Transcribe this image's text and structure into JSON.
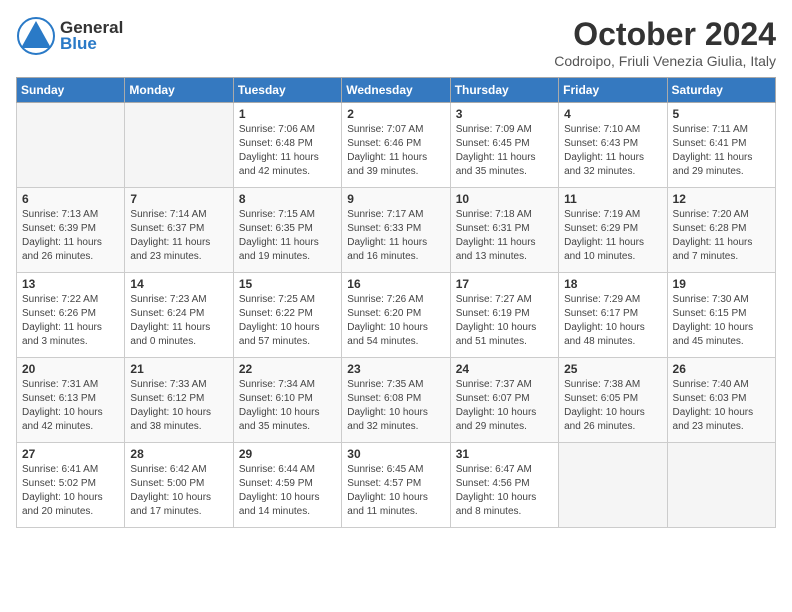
{
  "logo": {
    "text_general": "General",
    "text_blue": "Blue"
  },
  "title": "October 2024",
  "location": "Codroipo, Friuli Venezia Giulia, Italy",
  "days_of_week": [
    "Sunday",
    "Monday",
    "Tuesday",
    "Wednesday",
    "Thursday",
    "Friday",
    "Saturday"
  ],
  "weeks": [
    [
      {
        "day": "",
        "info": ""
      },
      {
        "day": "",
        "info": ""
      },
      {
        "day": "1",
        "info": "Sunrise: 7:06 AM\nSunset: 6:48 PM\nDaylight: 11 hours and 42 minutes."
      },
      {
        "day": "2",
        "info": "Sunrise: 7:07 AM\nSunset: 6:46 PM\nDaylight: 11 hours and 39 minutes."
      },
      {
        "day": "3",
        "info": "Sunrise: 7:09 AM\nSunset: 6:45 PM\nDaylight: 11 hours and 35 minutes."
      },
      {
        "day": "4",
        "info": "Sunrise: 7:10 AM\nSunset: 6:43 PM\nDaylight: 11 hours and 32 minutes."
      },
      {
        "day": "5",
        "info": "Sunrise: 7:11 AM\nSunset: 6:41 PM\nDaylight: 11 hours and 29 minutes."
      }
    ],
    [
      {
        "day": "6",
        "info": "Sunrise: 7:13 AM\nSunset: 6:39 PM\nDaylight: 11 hours and 26 minutes."
      },
      {
        "day": "7",
        "info": "Sunrise: 7:14 AM\nSunset: 6:37 PM\nDaylight: 11 hours and 23 minutes."
      },
      {
        "day": "8",
        "info": "Sunrise: 7:15 AM\nSunset: 6:35 PM\nDaylight: 11 hours and 19 minutes."
      },
      {
        "day": "9",
        "info": "Sunrise: 7:17 AM\nSunset: 6:33 PM\nDaylight: 11 hours and 16 minutes."
      },
      {
        "day": "10",
        "info": "Sunrise: 7:18 AM\nSunset: 6:31 PM\nDaylight: 11 hours and 13 minutes."
      },
      {
        "day": "11",
        "info": "Sunrise: 7:19 AM\nSunset: 6:29 PM\nDaylight: 11 hours and 10 minutes."
      },
      {
        "day": "12",
        "info": "Sunrise: 7:20 AM\nSunset: 6:28 PM\nDaylight: 11 hours and 7 minutes."
      }
    ],
    [
      {
        "day": "13",
        "info": "Sunrise: 7:22 AM\nSunset: 6:26 PM\nDaylight: 11 hours and 3 minutes."
      },
      {
        "day": "14",
        "info": "Sunrise: 7:23 AM\nSunset: 6:24 PM\nDaylight: 11 hours and 0 minutes."
      },
      {
        "day": "15",
        "info": "Sunrise: 7:25 AM\nSunset: 6:22 PM\nDaylight: 10 hours and 57 minutes."
      },
      {
        "day": "16",
        "info": "Sunrise: 7:26 AM\nSunset: 6:20 PM\nDaylight: 10 hours and 54 minutes."
      },
      {
        "day": "17",
        "info": "Sunrise: 7:27 AM\nSunset: 6:19 PM\nDaylight: 10 hours and 51 minutes."
      },
      {
        "day": "18",
        "info": "Sunrise: 7:29 AM\nSunset: 6:17 PM\nDaylight: 10 hours and 48 minutes."
      },
      {
        "day": "19",
        "info": "Sunrise: 7:30 AM\nSunset: 6:15 PM\nDaylight: 10 hours and 45 minutes."
      }
    ],
    [
      {
        "day": "20",
        "info": "Sunrise: 7:31 AM\nSunset: 6:13 PM\nDaylight: 10 hours and 42 minutes."
      },
      {
        "day": "21",
        "info": "Sunrise: 7:33 AM\nSunset: 6:12 PM\nDaylight: 10 hours and 38 minutes."
      },
      {
        "day": "22",
        "info": "Sunrise: 7:34 AM\nSunset: 6:10 PM\nDaylight: 10 hours and 35 minutes."
      },
      {
        "day": "23",
        "info": "Sunrise: 7:35 AM\nSunset: 6:08 PM\nDaylight: 10 hours and 32 minutes."
      },
      {
        "day": "24",
        "info": "Sunrise: 7:37 AM\nSunset: 6:07 PM\nDaylight: 10 hours and 29 minutes."
      },
      {
        "day": "25",
        "info": "Sunrise: 7:38 AM\nSunset: 6:05 PM\nDaylight: 10 hours and 26 minutes."
      },
      {
        "day": "26",
        "info": "Sunrise: 7:40 AM\nSunset: 6:03 PM\nDaylight: 10 hours and 23 minutes."
      }
    ],
    [
      {
        "day": "27",
        "info": "Sunrise: 6:41 AM\nSunset: 5:02 PM\nDaylight: 10 hours and 20 minutes."
      },
      {
        "day": "28",
        "info": "Sunrise: 6:42 AM\nSunset: 5:00 PM\nDaylight: 10 hours and 17 minutes."
      },
      {
        "day": "29",
        "info": "Sunrise: 6:44 AM\nSunset: 4:59 PM\nDaylight: 10 hours and 14 minutes."
      },
      {
        "day": "30",
        "info": "Sunrise: 6:45 AM\nSunset: 4:57 PM\nDaylight: 10 hours and 11 minutes."
      },
      {
        "day": "31",
        "info": "Sunrise: 6:47 AM\nSunset: 4:56 PM\nDaylight: 10 hours and 8 minutes."
      },
      {
        "day": "",
        "info": ""
      },
      {
        "day": "",
        "info": ""
      }
    ]
  ]
}
